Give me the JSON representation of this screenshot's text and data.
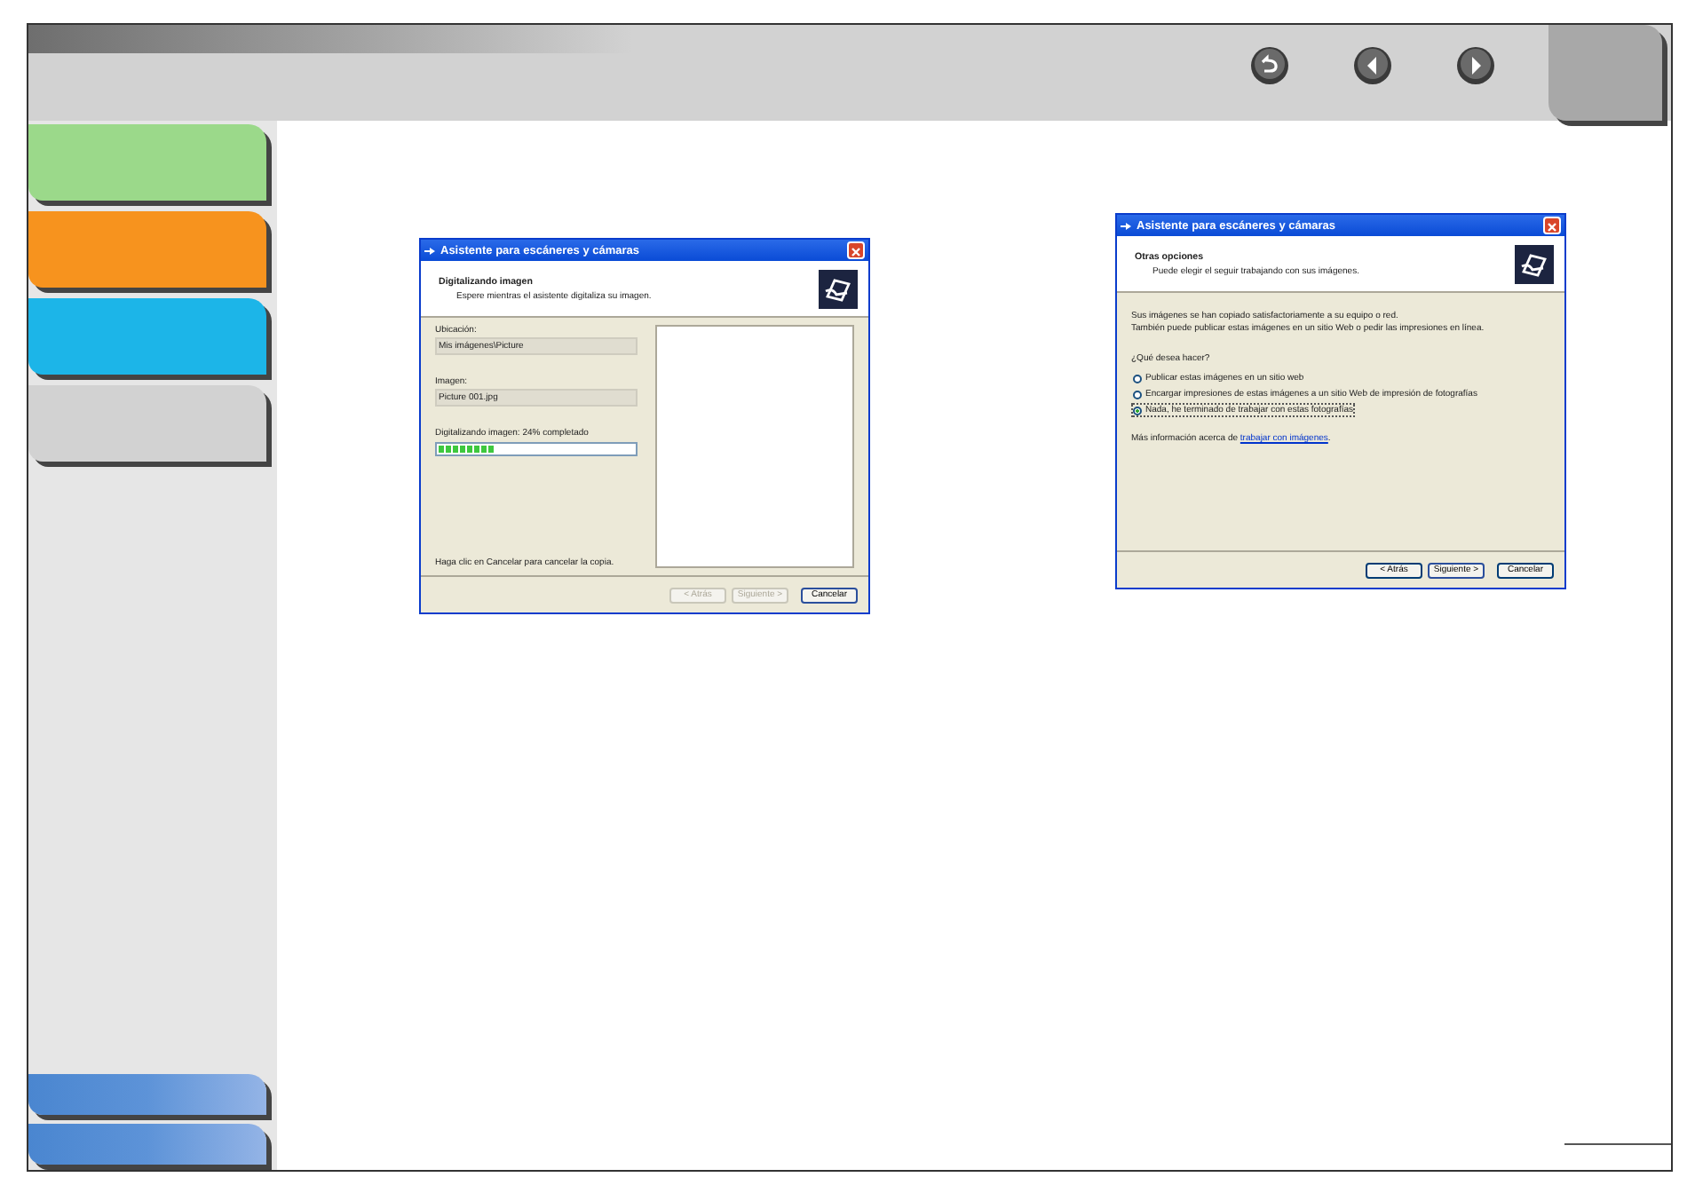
{
  "header": {
    "nav_buttons": [
      {
        "kind": "back"
      },
      {
        "kind": "previous"
      },
      {
        "kind": "next"
      }
    ]
  },
  "sidebar": {
    "tabs": [
      {
        "color": "#9bd98a"
      },
      {
        "color": "#f7931e"
      },
      {
        "color": "#1cb5e8"
      },
      {
        "color": "#d2d2d2"
      }
    ]
  },
  "dialogs": [
    {
      "title": "Asistente para escáneres y cámaras",
      "heading": "Digitalizando imagen",
      "subheading": "Espere mientras el asistente digitaliza su imagen.",
      "kind": "progress",
      "fields": [
        {
          "label": "Ubicación:",
          "value": "Mis imágenes\\Picture"
        },
        {
          "label": "Imagen:",
          "value": "Picture 001.jpg"
        }
      ],
      "progress": {
        "label": "Digitalizando imagen: 24% completado",
        "level": 0.28
      },
      "hint": "Haga clic en Cancelar para cancelar la copia.",
      "buttons": [
        {
          "label": "< Atrás",
          "disabled": true,
          "default": false
        },
        {
          "label": "Siguiente >",
          "disabled": true,
          "default": false
        },
        {
          "label": "Cancelar",
          "disabled": false,
          "default": true
        }
      ]
    },
    {
      "title": "Asistente para escáneres y cámaras",
      "heading": "Otras opciones",
      "subheading": "Puede elegir el seguir trabajando con sus imágenes.",
      "kind": "options",
      "paragraph": [
        "Sus imágenes se han copiado satisfactoriamente a su equipo o red.",
        "También puede publicar estas imágenes en un sitio Web o pedir las impresiones en línea."
      ],
      "question": "¿Qué desea hacer?",
      "options": [
        {
          "label": "Publicar estas imágenes en un sitio web",
          "selected": false
        },
        {
          "label": "Encargar impresiones de estas imágenes a un sitio Web de impresión de fotografías",
          "selected": false
        },
        {
          "label": "Nada, he terminado de trabajar con estas fotografías",
          "selected": true
        }
      ],
      "info": {
        "text": "Más información acerca de",
        "link": "trabajar con imágenes",
        "end": "."
      },
      "buttons": [
        {
          "label": "< Atrás",
          "disabled": false,
          "default": false
        },
        {
          "label": "Siguiente >",
          "disabled": false,
          "default": true
        },
        {
          "label": "Cancelar",
          "disabled": false,
          "default": false
        }
      ]
    }
  ]
}
